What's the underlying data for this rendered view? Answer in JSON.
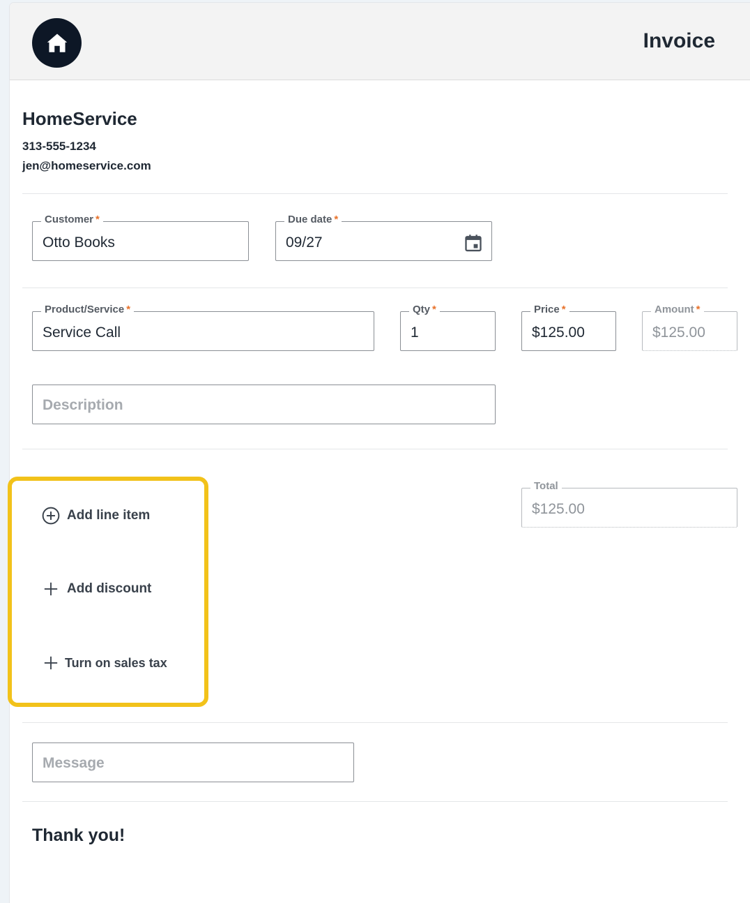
{
  "header": {
    "title": "Invoice",
    "home_icon": "home-icon"
  },
  "company": {
    "name": "HomeService",
    "phone": "313-555-1234",
    "email": "jen@homeservice.com"
  },
  "form": {
    "customer": {
      "label": "Customer",
      "required": "*",
      "value": "Otto Books"
    },
    "due_date": {
      "label": "Due date",
      "required": "*",
      "value": "09/27"
    },
    "product": {
      "label": "Product/Service",
      "required": "*",
      "value": "Service Call"
    },
    "qty": {
      "label": "Qty",
      "required": "*",
      "value": "1"
    },
    "price": {
      "label": "Price",
      "required": "*",
      "value": "$125.00"
    },
    "amount": {
      "label": "Amount",
      "required": "*",
      "value": "$125.00"
    },
    "description": {
      "placeholder": "Description"
    },
    "total": {
      "label": "Total",
      "value": "$125.00"
    },
    "message": {
      "placeholder": "Message"
    }
  },
  "actions": {
    "add_line_item": "Add line item",
    "add_discount": "Add discount",
    "sales_tax": "Turn on sales tax"
  },
  "footer": {
    "thanks": "Thank you!"
  },
  "colors": {
    "required_asterisk": "#e8722a",
    "highlight_border": "#f2c21a",
    "home_button": "#0d1726"
  }
}
